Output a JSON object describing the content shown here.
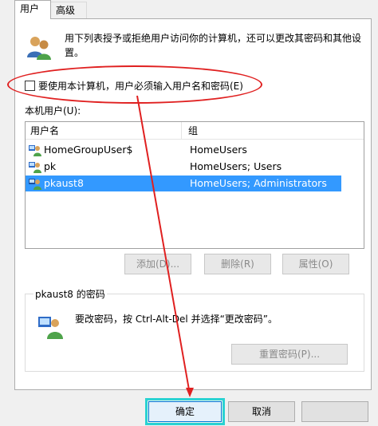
{
  "tabs": [
    {
      "label": "用户",
      "active": true
    },
    {
      "label": "高级",
      "active": false
    }
  ],
  "description": "用下列表授予或拒绝用户访问你的计算机，还可以更改其密码和其他设置。",
  "require_password": {
    "label": "要使用本计算机，用户必须输入用户名和密码(E)",
    "checked": false
  },
  "users_label": "本机用户(U):",
  "list": {
    "columns": [
      "用户名",
      "组"
    ],
    "rows": [
      {
        "name": "HomeGroupUser$",
        "group": "HomeUsers",
        "selected": false
      },
      {
        "name": "pk",
        "group": "HomeUsers; Users",
        "selected": false
      },
      {
        "name": "pkaust8",
        "group": "HomeUsers; Administrators",
        "selected": true
      }
    ]
  },
  "list_buttons": {
    "add": "添加(D)...",
    "remove": "删除(R)",
    "properties": "属性(O)"
  },
  "password_group": {
    "title": "pkaust8 的密码",
    "text": "要改密码，按 Ctrl-Alt-Del 并选择“更改密码”。",
    "reset_button": "重置密码(P)..."
  },
  "dialog_buttons": {
    "ok": "确定",
    "cancel": "取消",
    "apply": ""
  },
  "colors": {
    "selection": "#3399ff",
    "annotation_red": "#e02020",
    "annotation_cyan": "#2ad2d2"
  },
  "icons": {
    "users": "users-icon",
    "user": "user-icon",
    "key_user": "password-user-icon"
  }
}
